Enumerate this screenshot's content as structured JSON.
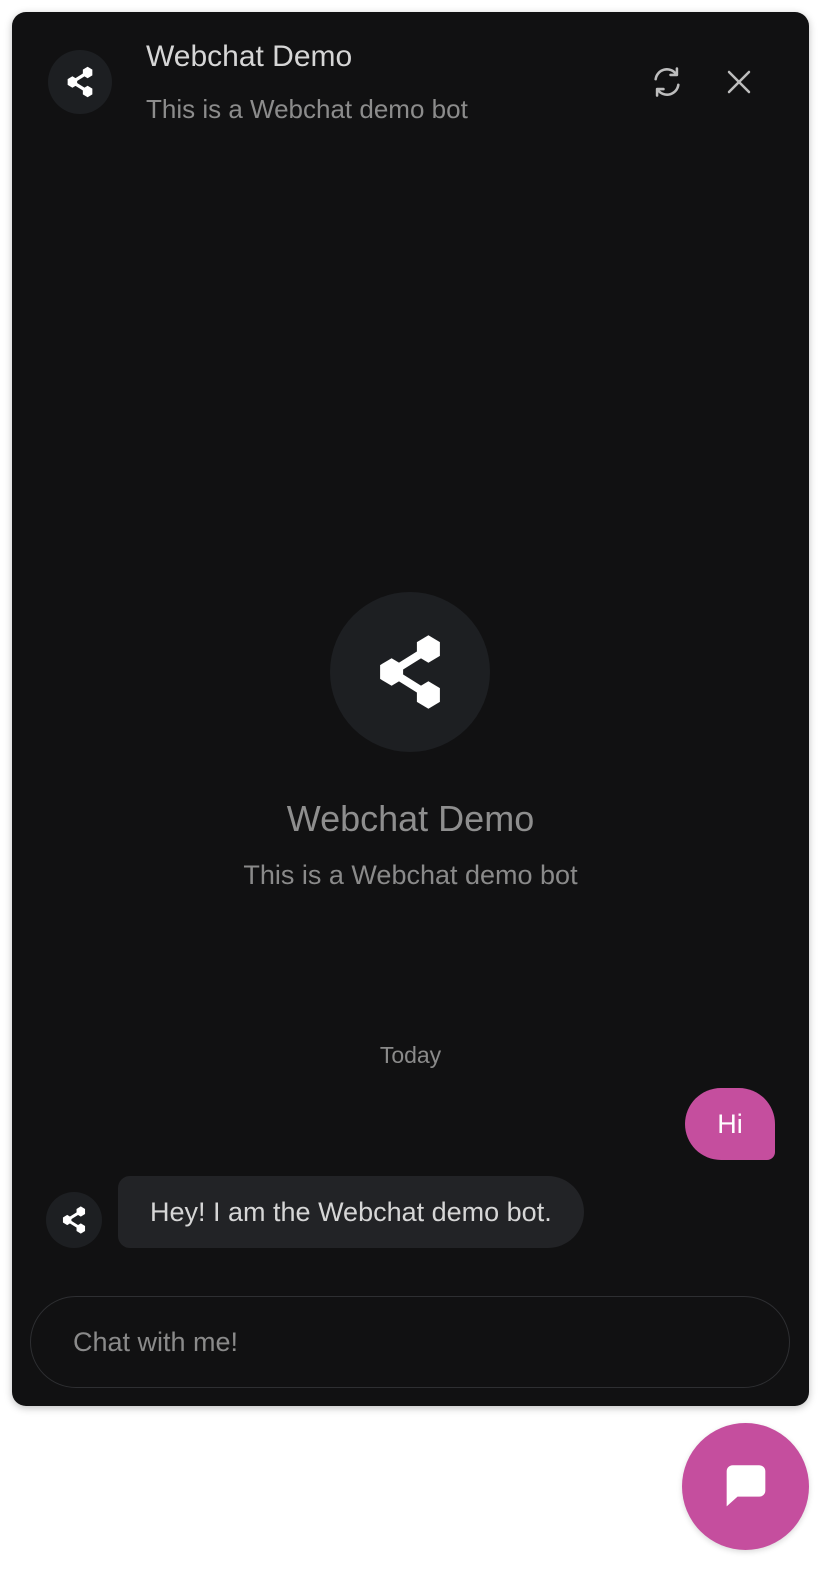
{
  "header": {
    "title": "Webchat Demo",
    "subtitle": "This is a Webchat demo bot",
    "avatar_icon": "share-nodes-icon",
    "refresh_icon": "refresh-icon",
    "close_icon": "close-icon"
  },
  "welcome": {
    "title": "Webchat Demo",
    "subtitle": "This is a Webchat demo bot",
    "avatar_icon": "share-nodes-icon"
  },
  "conversation": {
    "date_divider": "Today",
    "messages": [
      {
        "sender": "user",
        "text": "Hi"
      },
      {
        "sender": "bot",
        "text": "Hey! I am the Webchat demo bot."
      }
    ]
  },
  "composer": {
    "placeholder": "Chat with me!",
    "value": ""
  },
  "launcher": {
    "icon": "chat-bubble-icon"
  },
  "colors": {
    "accent": "#c54e9e",
    "background": "#111112",
    "avatar_bg": "#1d1f22",
    "bot_bubble": "#222326"
  }
}
